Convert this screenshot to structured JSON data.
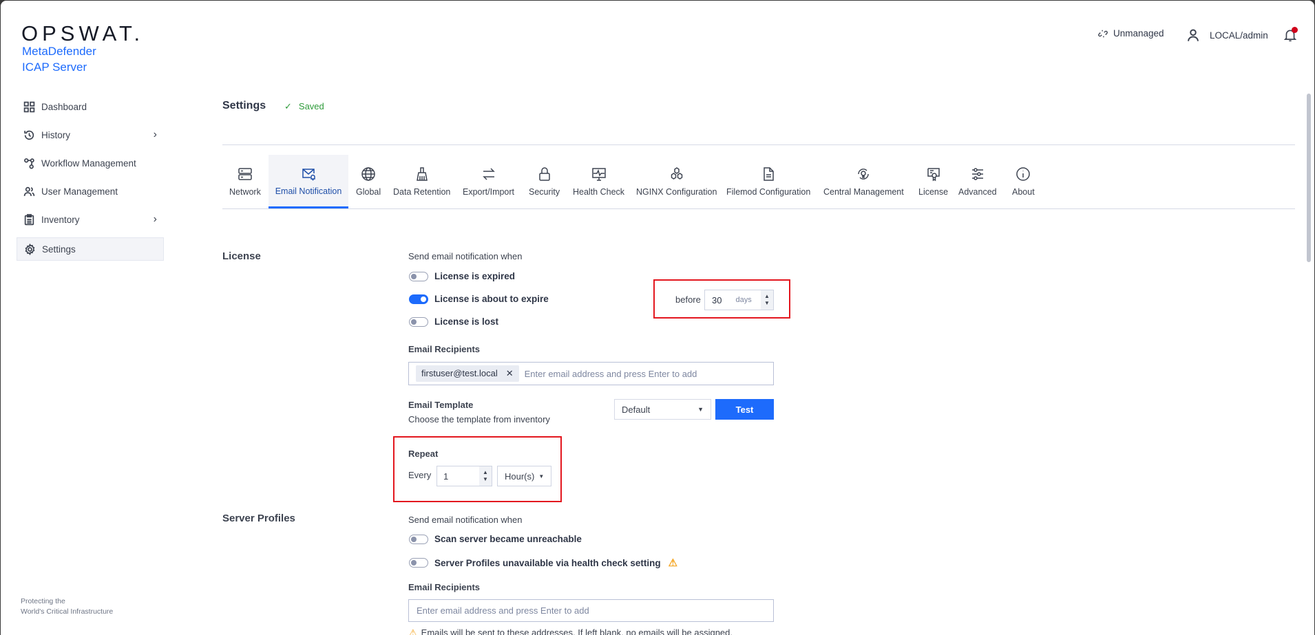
{
  "brand": {
    "logo": "OPSWAT.",
    "product_line1": "MetaDefender",
    "product_line2": "ICAP Server"
  },
  "sidebar": {
    "items": [
      {
        "label": "Dashboard",
        "icon": "grid-icon"
      },
      {
        "label": "History",
        "icon": "history-icon"
      },
      {
        "label": "Workflow Management",
        "icon": "workflow-icon"
      },
      {
        "label": "User Management",
        "icon": "users-icon"
      },
      {
        "label": "Inventory",
        "icon": "clipboard-icon"
      },
      {
        "label": "Settings",
        "icon": "gear-icon",
        "active": true
      }
    ],
    "footer_line1": "Protecting the",
    "footer_line2": "World's Critical Infrastructure"
  },
  "topbar": {
    "managed_status": "Unmanaged",
    "user": "LOCAL/admin",
    "notification_dot_color": "#d0021b"
  },
  "header": {
    "title": "Settings",
    "status": "Saved"
  },
  "tabs": [
    "Network",
    "Email Notification",
    "Global",
    "Data Retention",
    "Export/Import",
    "Security",
    "Health Check",
    "NGINX Configuration",
    "Filemod Configuration",
    "Central Management",
    "License",
    "Advanced",
    "About"
  ],
  "license": {
    "title": "License",
    "send_when": "Send email notification when",
    "toggles": [
      {
        "label": "License is expired",
        "on": false
      },
      {
        "label": "License is about to expire",
        "on": true
      },
      {
        "label": "License is lost",
        "on": false
      }
    ],
    "before_label": "before",
    "before_value": "30",
    "before_unit": "days",
    "recipients_label": "Email Recipients",
    "recipient_chip": "firstuser@test.local",
    "recipients_placeholder": "Enter email address and press Enter to add",
    "template_label": "Email Template",
    "template_hint": "Choose the template from inventory",
    "template_value": "Default",
    "test_button": "Test",
    "repeat_label": "Repeat",
    "every_label": "Every",
    "repeat_value": "1",
    "repeat_unit": "Hour(s)"
  },
  "server_profiles": {
    "title": "Server Profiles",
    "send_when": "Send email notification when",
    "toggles": [
      {
        "label": "Scan server became unreachable",
        "on": false
      },
      {
        "label": "Server Profiles unavailable via health check setting",
        "on": false
      }
    ],
    "recipients_label": "Email Recipients",
    "recipients_placeholder": "Enter email address and press Enter to add",
    "warning": "Emails will be sent to these addresses. If left blank, no emails will be assigned."
  },
  "colors": {
    "accent": "#1d6bfc",
    "saved": "#2e9b3a",
    "highlight": "#e3161e"
  }
}
